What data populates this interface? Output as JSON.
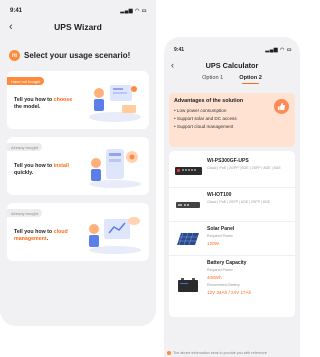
{
  "wizard": {
    "status_time": "9:41",
    "status_icons": "▂▄▆ ◠ ▭",
    "back_icon": "chevron-left-icon",
    "title": "UPS Wizard",
    "prompt_badge": "Hi",
    "prompt": "Select your usage scenario!",
    "cards": [
      {
        "tag": "Have not bought",
        "text_before": "Tell you how to ",
        "highlight": "choose",
        "text_after": " the model."
      },
      {
        "tag": "Already bought",
        "text_before": "Tell you how to ",
        "highlight": "install",
        "text_after": " quickly."
      },
      {
        "tag": "Already bought",
        "text_before": "Tell you how to ",
        "highlight": "cloud management",
        "text_after": "."
      }
    ]
  },
  "calculator": {
    "status_time": "9:41",
    "status_icons": "▂▄▆ ◠ ▭",
    "back_icon": "chevron-left-icon",
    "title": "UPS Calculator",
    "tabs": [
      "Option 1",
      "Option 2"
    ],
    "active_tab": 1,
    "advantages_title": "Advantages of the solution",
    "advantages": [
      "• Low power consumption",
      "• Support solar and DC access",
      "• Support cloud management"
    ],
    "products": [
      {
        "name": "WI-PS300GF-UPS",
        "desc": "Cloud | PoE | 2GPP | 6GE | 2SFP | 8GE | 8GE"
      },
      {
        "name": "WI-IOT100",
        "desc": "Cloud | PoE | 2SFP | 6GE | 2SFP | 8GE"
      }
    ],
    "solar": {
      "name": "Solar Panel",
      "sub": "Required Power",
      "value": "120W"
    },
    "battery": {
      "name": "Battery Capacity",
      "sub": "Required Power",
      "value": "408Wh",
      "sub2": "Recommend Battery",
      "value2": "12V 34Ah / 24V 17Ah"
    },
    "footnote": "The above information aims to provide you with reference"
  },
  "colors": {
    "accent": "#ff6a1a",
    "accent_soft": "#ffe2d1",
    "background": "#f1f1f3"
  }
}
